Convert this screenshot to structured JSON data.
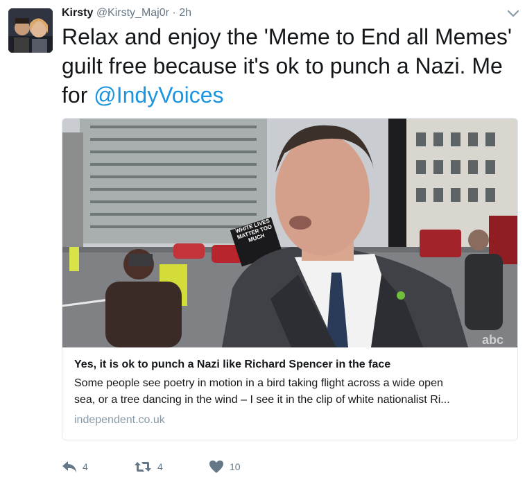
{
  "tweet": {
    "display_name": "Kirsty",
    "handle": "@Kirsty_Maj0r",
    "separator": "·",
    "time": "2h",
    "text_before": "Relax and enjoy the 'Meme to End all Memes' guilt free because it's ok to punch a Nazi. Me for ",
    "mention": "@IndyVoices"
  },
  "card": {
    "title": "Yes, it is ok to punch a Nazi like Richard Spencer in the face",
    "description_line1": "Some people see poetry in motion in a bird taking flight across a wide open",
    "description_line2": "sea, or a tree dancing in the wind – I see it in the clip of white nationalist Ri...",
    "domain": "independent.co.uk",
    "sign_text": "WHITE LIVES MATTER TOO MUCH"
  },
  "actions": {
    "reply_count": "4",
    "retweet_count": "4",
    "like_count": "10"
  },
  "icons": [
    "avatar",
    "chevron-down-icon",
    "reply-icon",
    "retweet-icon",
    "heart-icon"
  ],
  "colors": {
    "link": "#1b95e0",
    "muted": "#657786",
    "domain": "#8899a6",
    "border": "#e1e8ed"
  }
}
